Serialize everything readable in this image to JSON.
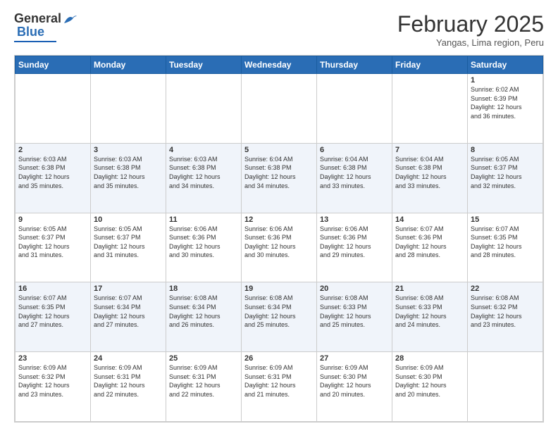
{
  "header": {
    "logo_general": "General",
    "logo_blue": "Blue",
    "month_year": "February 2025",
    "location": "Yangas, Lima region, Peru"
  },
  "days_of_week": [
    "Sunday",
    "Monday",
    "Tuesday",
    "Wednesday",
    "Thursday",
    "Friday",
    "Saturday"
  ],
  "weeks": [
    [
      {
        "day": "",
        "info": ""
      },
      {
        "day": "",
        "info": ""
      },
      {
        "day": "",
        "info": ""
      },
      {
        "day": "",
        "info": ""
      },
      {
        "day": "",
        "info": ""
      },
      {
        "day": "",
        "info": ""
      },
      {
        "day": "1",
        "info": "Sunrise: 6:02 AM\nSunset: 6:39 PM\nDaylight: 12 hours\nand 36 minutes."
      }
    ],
    [
      {
        "day": "2",
        "info": "Sunrise: 6:03 AM\nSunset: 6:38 PM\nDaylight: 12 hours\nand 35 minutes."
      },
      {
        "day": "3",
        "info": "Sunrise: 6:03 AM\nSunset: 6:38 PM\nDaylight: 12 hours\nand 35 minutes."
      },
      {
        "day": "4",
        "info": "Sunrise: 6:03 AM\nSunset: 6:38 PM\nDaylight: 12 hours\nand 34 minutes."
      },
      {
        "day": "5",
        "info": "Sunrise: 6:04 AM\nSunset: 6:38 PM\nDaylight: 12 hours\nand 34 minutes."
      },
      {
        "day": "6",
        "info": "Sunrise: 6:04 AM\nSunset: 6:38 PM\nDaylight: 12 hours\nand 33 minutes."
      },
      {
        "day": "7",
        "info": "Sunrise: 6:04 AM\nSunset: 6:38 PM\nDaylight: 12 hours\nand 33 minutes."
      },
      {
        "day": "8",
        "info": "Sunrise: 6:05 AM\nSunset: 6:37 PM\nDaylight: 12 hours\nand 32 minutes."
      }
    ],
    [
      {
        "day": "9",
        "info": "Sunrise: 6:05 AM\nSunset: 6:37 PM\nDaylight: 12 hours\nand 31 minutes."
      },
      {
        "day": "10",
        "info": "Sunrise: 6:05 AM\nSunset: 6:37 PM\nDaylight: 12 hours\nand 31 minutes."
      },
      {
        "day": "11",
        "info": "Sunrise: 6:06 AM\nSunset: 6:36 PM\nDaylight: 12 hours\nand 30 minutes."
      },
      {
        "day": "12",
        "info": "Sunrise: 6:06 AM\nSunset: 6:36 PM\nDaylight: 12 hours\nand 30 minutes."
      },
      {
        "day": "13",
        "info": "Sunrise: 6:06 AM\nSunset: 6:36 PM\nDaylight: 12 hours\nand 29 minutes."
      },
      {
        "day": "14",
        "info": "Sunrise: 6:07 AM\nSunset: 6:36 PM\nDaylight: 12 hours\nand 28 minutes."
      },
      {
        "day": "15",
        "info": "Sunrise: 6:07 AM\nSunset: 6:35 PM\nDaylight: 12 hours\nand 28 minutes."
      }
    ],
    [
      {
        "day": "16",
        "info": "Sunrise: 6:07 AM\nSunset: 6:35 PM\nDaylight: 12 hours\nand 27 minutes."
      },
      {
        "day": "17",
        "info": "Sunrise: 6:07 AM\nSunset: 6:34 PM\nDaylight: 12 hours\nand 27 minutes."
      },
      {
        "day": "18",
        "info": "Sunrise: 6:08 AM\nSunset: 6:34 PM\nDaylight: 12 hours\nand 26 minutes."
      },
      {
        "day": "19",
        "info": "Sunrise: 6:08 AM\nSunset: 6:34 PM\nDaylight: 12 hours\nand 25 minutes."
      },
      {
        "day": "20",
        "info": "Sunrise: 6:08 AM\nSunset: 6:33 PM\nDaylight: 12 hours\nand 25 minutes."
      },
      {
        "day": "21",
        "info": "Sunrise: 6:08 AM\nSunset: 6:33 PM\nDaylight: 12 hours\nand 24 minutes."
      },
      {
        "day": "22",
        "info": "Sunrise: 6:08 AM\nSunset: 6:32 PM\nDaylight: 12 hours\nand 23 minutes."
      }
    ],
    [
      {
        "day": "23",
        "info": "Sunrise: 6:09 AM\nSunset: 6:32 PM\nDaylight: 12 hours\nand 23 minutes."
      },
      {
        "day": "24",
        "info": "Sunrise: 6:09 AM\nSunset: 6:31 PM\nDaylight: 12 hours\nand 22 minutes."
      },
      {
        "day": "25",
        "info": "Sunrise: 6:09 AM\nSunset: 6:31 PM\nDaylight: 12 hours\nand 22 minutes."
      },
      {
        "day": "26",
        "info": "Sunrise: 6:09 AM\nSunset: 6:31 PM\nDaylight: 12 hours\nand 21 minutes."
      },
      {
        "day": "27",
        "info": "Sunrise: 6:09 AM\nSunset: 6:30 PM\nDaylight: 12 hours\nand 20 minutes."
      },
      {
        "day": "28",
        "info": "Sunrise: 6:09 AM\nSunset: 6:30 PM\nDaylight: 12 hours\nand 20 minutes."
      },
      {
        "day": "",
        "info": ""
      }
    ]
  ]
}
